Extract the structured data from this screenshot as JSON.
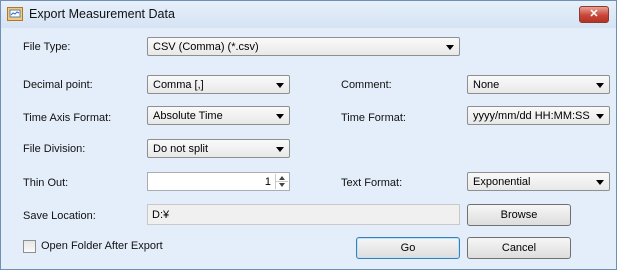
{
  "window": {
    "title": "Export Measurement Data",
    "close_label": "✕"
  },
  "form": {
    "file_type": {
      "label": "File Type:",
      "value": "CSV (Comma) (*.csv)"
    },
    "decimal_point": {
      "label": "Decimal point:",
      "value": "Comma [,]"
    },
    "comment": {
      "label": "Comment:",
      "value": "None"
    },
    "time_axis_format": {
      "label": "Time Axis Format:",
      "value": "Absolute Time"
    },
    "time_format": {
      "label": "Time Format:",
      "value": "yyyy/mm/dd HH:MM:SS"
    },
    "file_division": {
      "label": "File Division:",
      "value": "Do not split"
    },
    "thin_out": {
      "label": "Thin Out:",
      "value": "1"
    },
    "text_format": {
      "label": "Text Format:",
      "value": "Exponential"
    },
    "save_location": {
      "label": "Save Location:",
      "value": "D:¥"
    },
    "open_folder": {
      "label": "Open Folder After Export",
      "checked": false
    }
  },
  "buttons": {
    "browse": "Browse",
    "go": "Go",
    "cancel": "Cancel"
  },
  "colors": {
    "titlebar": "#dbe7f6",
    "client_bg": "#f0f0f0",
    "close": "#c8473a"
  }
}
